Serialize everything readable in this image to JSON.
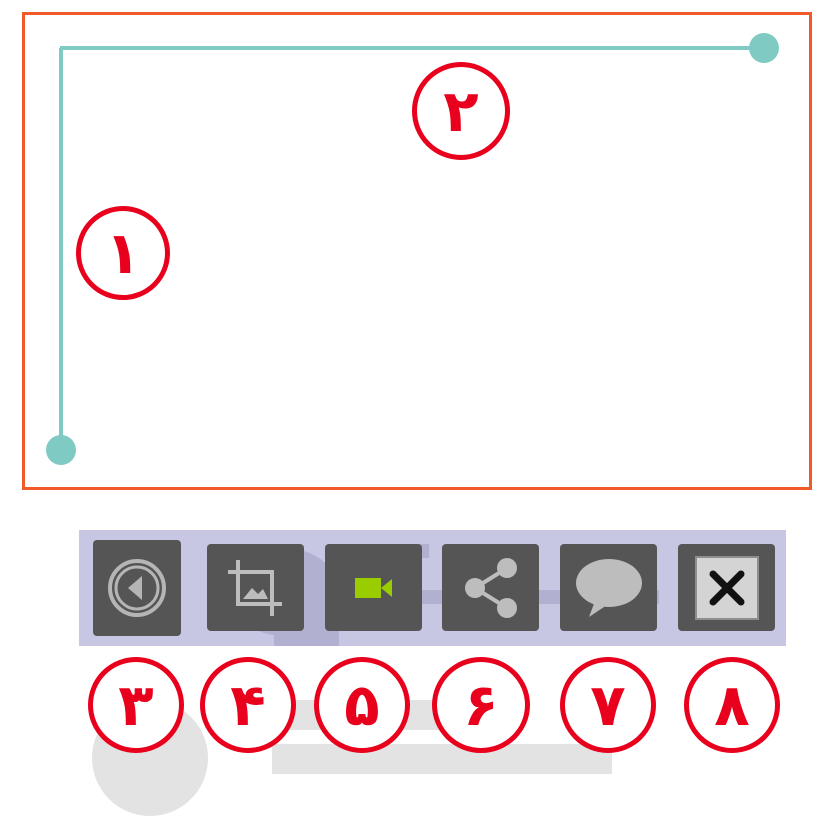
{
  "markers": {
    "m1": "١",
    "m2": "٢",
    "m3": "٣",
    "m4": "۴",
    "m5": "۵",
    "m6": "۶",
    "m7": "٧",
    "m8": "٨"
  },
  "toolbar": {
    "buttons": [
      {
        "name": "back",
        "icon": "back-arrow-icon"
      },
      {
        "name": "crop",
        "icon": "crop-icon"
      },
      {
        "name": "video",
        "icon": "video-camera-icon"
      },
      {
        "name": "share",
        "icon": "share-icon"
      },
      {
        "name": "comment",
        "icon": "speech-bubble-icon"
      },
      {
        "name": "close",
        "icon": "close-icon"
      }
    ]
  },
  "colors": {
    "frame_border": "#f05a28",
    "guide": "#7fcbc4",
    "marker": "#e8001c",
    "toolbar_bg": "#c7c6e3",
    "button_bg": "#555555",
    "video_accent": "#9acd00"
  }
}
